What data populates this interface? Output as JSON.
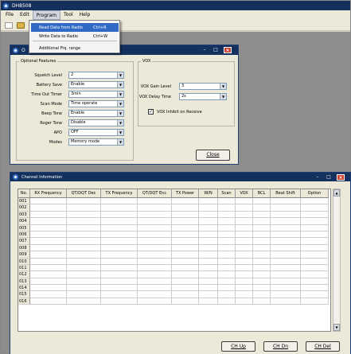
{
  "app": {
    "title": "DH8508"
  },
  "menu": {
    "items": [
      "File",
      "Edit",
      "Program",
      "Tool",
      "Help"
    ]
  },
  "program_menu": {
    "items": [
      {
        "label": "Read Data from Radio",
        "shortcut": "Ctrl+R"
      },
      {
        "label": "Write Data to Radio",
        "shortcut": "Ctrl+W"
      },
      {
        "label": "Additional Frq. range",
        "shortcut": ""
      }
    ]
  },
  "dialog": {
    "title": "O",
    "optional_features": {
      "legend": "Optional Features",
      "rows": [
        {
          "label": "Squelch Level",
          "value": "2"
        },
        {
          "label": "Battery Save",
          "value": "Enable"
        },
        {
          "label": "Time Out Timer",
          "value": "3min"
        },
        {
          "label": "Scan Mode",
          "value": "Time operate"
        },
        {
          "label": "Beep Tone",
          "value": "Enable"
        },
        {
          "label": "Roger Tone",
          "value": "Disable"
        },
        {
          "label": "APO",
          "value": "OFF"
        },
        {
          "label": "Modes",
          "value": "Memory mode"
        }
      ]
    },
    "vox": {
      "legend": "VOX",
      "rows": [
        {
          "label": "VOX Gain Level",
          "value": "3"
        },
        {
          "label": "VOX Delay Time",
          "value": "2s"
        }
      ],
      "inhibit_label": "VOX Inhibit on Receive",
      "inhibit_checked": "✓"
    },
    "close_label": "Close"
  },
  "channel_window": {
    "title": "Channel Information",
    "columns": [
      "No.",
      "RX Frequency",
      "QT/DQT Dec",
      "TX Frequency",
      "QT/DQT Enc",
      "TX Power",
      "W/N",
      "Scan",
      "VOX",
      "BCL",
      "Beat Shift",
      "Option"
    ],
    "rows": [
      "001",
      "002",
      "003",
      "004",
      "005",
      "006",
      "007",
      "008",
      "009",
      "010",
      "011",
      "012",
      "013",
      "014",
      "015",
      "016"
    ],
    "buttons": [
      "CH Up",
      "CH Dn",
      "CH Del"
    ]
  }
}
